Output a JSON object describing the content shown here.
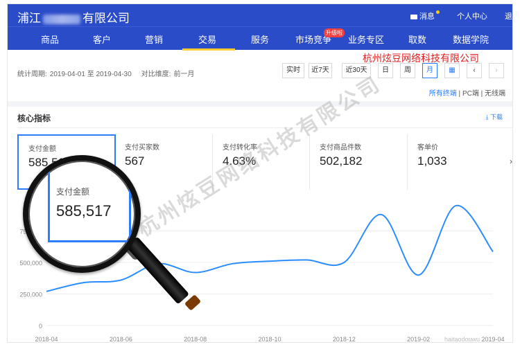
{
  "header": {
    "shop_prefix": "浦江",
    "shop_suffix": "有限公司",
    "message": "消息",
    "profile": "个人中心",
    "logout": "退"
  },
  "nav": {
    "items": [
      "商品",
      "客户",
      "营销",
      "交易",
      "服务",
      "市场竞争",
      "业务专区",
      "取数",
      "数据学院"
    ],
    "active": "交易",
    "upgrade_badge": "升级啦"
  },
  "filter": {
    "period_label": "统计周期:",
    "period_value": "2019-04-01 至 2019-04-30",
    "compare_label": "对比维度:",
    "compare_value": "前一月",
    "buttons": [
      "实时",
      "近7天",
      "近30天",
      "日",
      "周",
      "月"
    ],
    "active_button": "月",
    "terminals": [
      "所有终端",
      "PC端",
      "无线端"
    ],
    "active_terminal": "所有终端"
  },
  "overlay_company": "杭州炫豆网络科技有限公司",
  "core": {
    "title": "核心指标",
    "download": "下载",
    "metrics": [
      {
        "label": "支付金额",
        "value": "585,517"
      },
      {
        "label": "支付买家数",
        "value": "567"
      },
      {
        "label": "支付转化率",
        "value": "4.63%"
      },
      {
        "label": "支付商品件数",
        "value": "502,182"
      },
      {
        "label": "客单价",
        "value": "1,033"
      }
    ]
  },
  "magnifier": {
    "label": "支付金额",
    "value": "585,517"
  },
  "watermark": "杭州炫豆网络科技有限公司",
  "watermark_small": "haitaodouwu",
  "chart_data": {
    "type": "line",
    "x": [
      "2018-04",
      "2018-05",
      "2018-06",
      "2018-07",
      "2018-08",
      "2018-09",
      "2018-10",
      "2018-11",
      "2018-12",
      "2019-01",
      "2019-02",
      "2019-03",
      "2019-04"
    ],
    "xticks": [
      "2018-04",
      "2018-06",
      "2018-08",
      "2018-10",
      "2018-12",
      "2019-02",
      "2019-04"
    ],
    "yticks": [
      "0",
      "250,000",
      "500,000",
      "750,000"
    ],
    "ylim": [
      0,
      1000000
    ],
    "series": [
      {
        "values": [
          270000,
          340000,
          360000,
          490000,
          420000,
          490000,
          510000,
          520000,
          500000,
          880000,
          400000,
          950000,
          585517
        ]
      }
    ],
    "color": "#2b8cff",
    "grid": true
  }
}
